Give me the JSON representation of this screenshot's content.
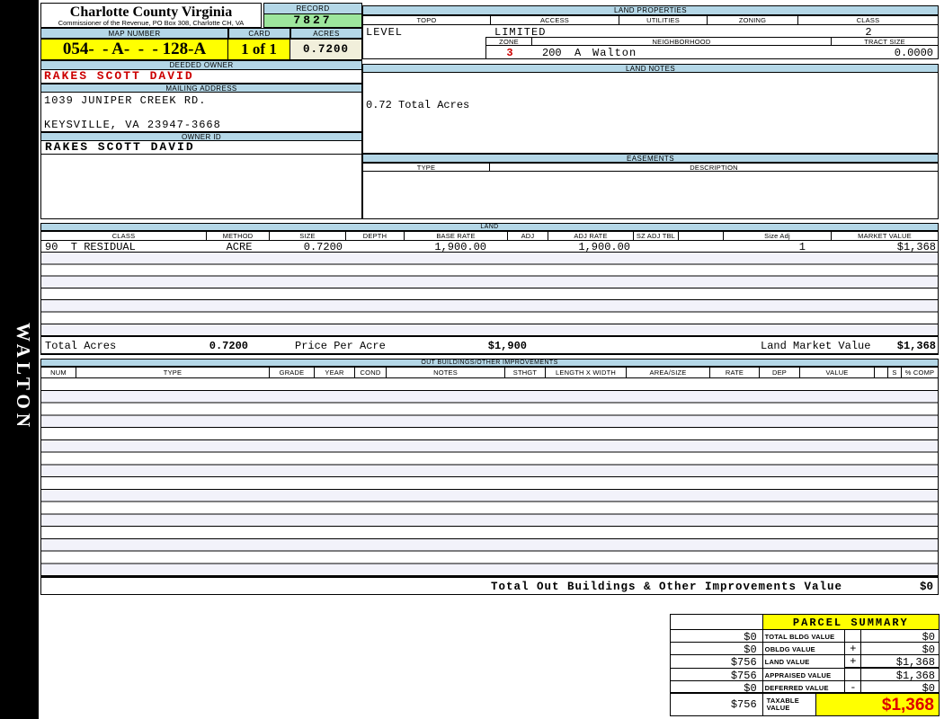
{
  "header": {
    "county_title": "Charlotte County Virginia",
    "commissioner_line": "Commissioner of the Revenue, PO Box 308, Charlotte CH, VA",
    "record_label": "RECORD",
    "record_value": "7827",
    "map_number_label": "MAP NUMBER",
    "map_number_value": "054-  - A-  -  - 128-A",
    "card_label": "CARD",
    "card_value": "1 of 1",
    "acres_label": "ACRES",
    "acres_value": "0.7200"
  },
  "owner": {
    "deeded_owner_label": "DEEDED OWNER",
    "deeded_owner": "RAKES SCOTT DAVID",
    "mailing_address_label": "MAILING ADDRESS",
    "address_line1": "1039 JUNIPER CREEK RD.",
    "address_line2": "KEYSVILLE, VA 23947-3668",
    "owner_id_label": "OWNER ID",
    "owner_id": "RAKES SCOTT DAVID"
  },
  "land_properties": {
    "title": "LAND PROPERTIES",
    "columns": [
      "TOPO",
      "ACCESS",
      "UTILITIES",
      "ZONING",
      "CLASS"
    ],
    "topo": "LEVEL",
    "access": "LIMITED",
    "class": "2",
    "zone_label": "ZONE",
    "neighborhood_label": "NEIGHBORHOOD",
    "tract_size_label": "TRACT SIZE",
    "zone": "3",
    "neighborhood_code": "200  A",
    "neighborhood_name": "Walton",
    "tract_size": "0.0000"
  },
  "land_notes": {
    "title": "LAND NOTES",
    "note": "0.72 Total Acres"
  },
  "easements": {
    "title": "EASEMENTS",
    "type_label": "TYPE",
    "description_label": "DESCRIPTION"
  },
  "land": {
    "title": "LAND",
    "columns": [
      "CLASS",
      "METHOD",
      "SIZE",
      "DEPTH",
      "BASE RATE",
      "ADJ",
      "ADJ RATE",
      "SZ ADJ TBL",
      "",
      "Size Adj",
      "MARKET VALUE"
    ],
    "row": {
      "class": "90  T RESIDUAL",
      "method": "ACRE",
      "size": "0.7200",
      "base_rate": "1,900.00",
      "adj_rate": "1,900.00",
      "size_adj": "1",
      "market_value": "$1,368"
    },
    "totals": {
      "total_acres_label": "Total Acres",
      "total_acres": "0.7200",
      "price_per_acre_label": "Price Per Acre",
      "price_per_acre": "$1,900",
      "land_market_value_label": "Land Market Value",
      "land_market_value": "$1,368"
    }
  },
  "out_buildings": {
    "title": "OUT BUILDINGS/OTHER IMPROVEMENTS",
    "columns": [
      "NUM",
      "TYPE",
      "GRADE",
      "YEAR",
      "COND",
      "NOTES",
      "STHGT",
      "LENGTH X WIDTH",
      "AREA/SIZE",
      "RATE",
      "DEP",
      "VALUE",
      "",
      "S",
      "% COMP"
    ],
    "total_label": "Total Out Buildings & Other Improvements Value",
    "total_value": "$0"
  },
  "sidebar": {
    "district": "WALTON"
  },
  "parcel_summary": {
    "title": "PARCEL SUMMARY",
    "rows": [
      {
        "assessed": "$0",
        "label": "TOTAL BLDG VALUE",
        "op": "",
        "value": "$0"
      },
      {
        "assessed": "$0",
        "label": "OBLDG VALUE",
        "op": "+",
        "value": "$0"
      },
      {
        "assessed": "$756",
        "label": "LAND VALUE",
        "op": "+",
        "value": "$1,368"
      },
      {
        "assessed": "$756",
        "label": "APPRAISED VALUE",
        "op": "",
        "value": "$1,368"
      },
      {
        "assessed": "$0",
        "label": "DEFERRED VALUE",
        "op": "-",
        "value": "$0"
      },
      {
        "assessed": "$756",
        "label": "TAXABLE VALUE",
        "op": "",
        "value": "$1,368"
      }
    ]
  },
  "colors": {
    "header_blue": "#b4d7e7",
    "record_green": "#9de69d",
    "highlight_yellow": "#ffff00",
    "acres_cream": "#f1efdb",
    "row_stripe": "#f2f2fa",
    "alert_red": "#cc0000"
  }
}
